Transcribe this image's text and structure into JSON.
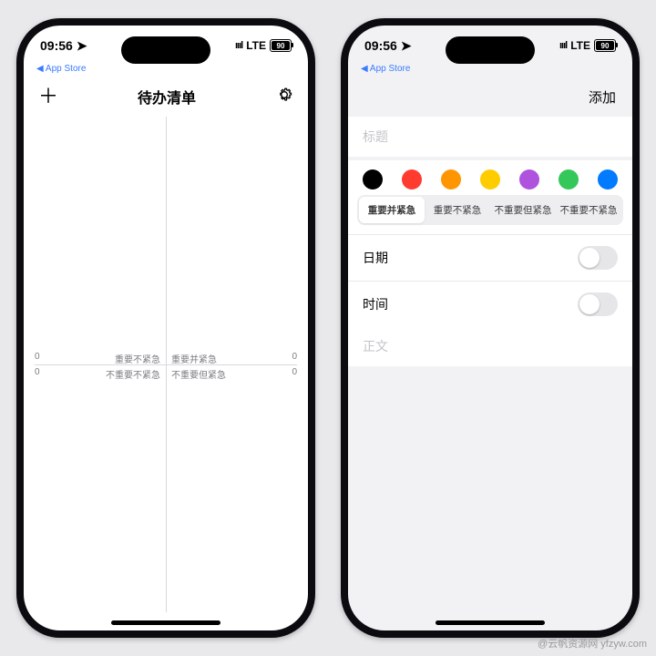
{
  "status": {
    "time": "09:56",
    "carrier_label": "LTE",
    "battery_pct": "90",
    "app_store_crumb": "App Store"
  },
  "list_screen": {
    "title": "待办清单",
    "quadrants": {
      "top_left": {
        "label": "重要不紧急",
        "count": "0"
      },
      "top_right": {
        "label": "重要并紧急",
        "count": "0"
      },
      "bottom_left": {
        "label": "不重要不紧急",
        "count": "0"
      },
      "bottom_right": {
        "label": "不重要但紧急",
        "count": "0"
      }
    }
  },
  "add_screen": {
    "nav_action": "添加",
    "title_placeholder": "标题",
    "body_placeholder": "正文",
    "colors": [
      "#000000",
      "#ff3b30",
      "#ff9500",
      "#ffcc00",
      "#af52de",
      "#34c759",
      "#007aff"
    ],
    "segments": [
      "重要并紧急",
      "重要不紧急",
      "不重要但紧急",
      "不重要不紧急"
    ],
    "segment_selected_index": 0,
    "date_label": "日期",
    "time_label": "时间"
  },
  "watermark": "@云帆资源网 yfzyw.com"
}
